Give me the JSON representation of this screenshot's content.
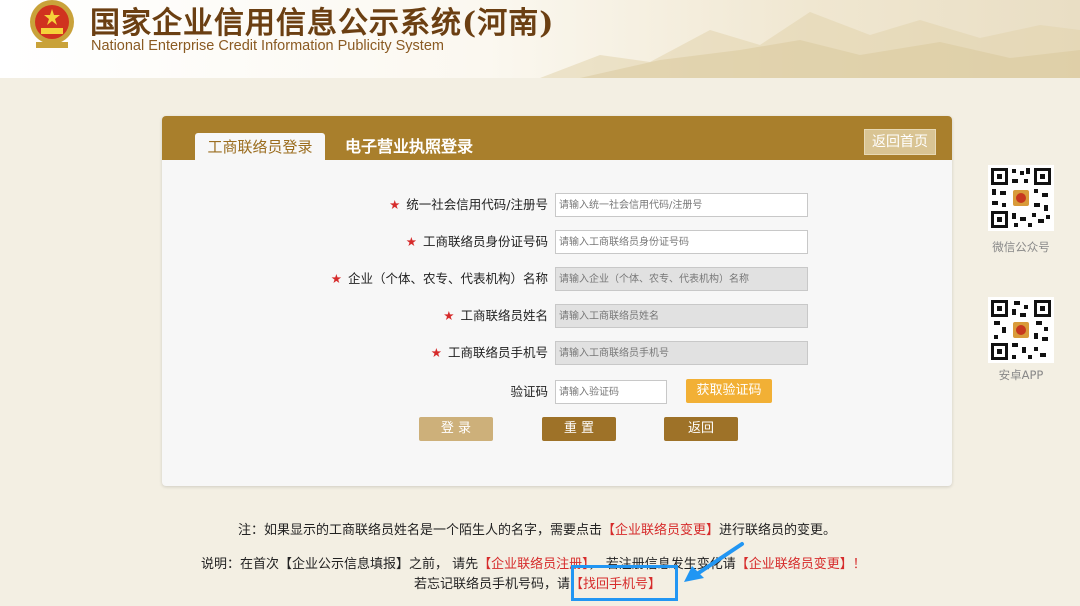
{
  "header": {
    "title_cn": "国家企业信用信息公示系统(河南)",
    "title_en": "National Enterprise Credit Information Publicity System"
  },
  "tabs": {
    "active": "工商联络员登录",
    "inactive": "电子营业执照登录",
    "home_button": "返回首页"
  },
  "form": {
    "fields": [
      {
        "label": "统一社会信用代码/注册号",
        "required": true,
        "placeholder": "请输入统一社会信用代码/注册号",
        "disabled": false
      },
      {
        "label": "工商联络员身份证号码",
        "required": true,
        "placeholder": "请输入工商联络员身份证号码",
        "disabled": false
      },
      {
        "label": "企业（个体、农专、代表机构）名称",
        "required": true,
        "placeholder": "请输入企业（个体、农专、代表机构）名称",
        "disabled": true
      },
      {
        "label": "工商联络员姓名",
        "required": true,
        "placeholder": "请输入工商联络员姓名",
        "disabled": true
      },
      {
        "label": "工商联络员手机号",
        "required": true,
        "placeholder": "请输入工商联络员手机号",
        "disabled": true
      }
    ],
    "star": "★",
    "captcha_label": "验证码",
    "captcha_placeholder": "请输入验证码",
    "get_code_button": "获取验证码",
    "login_button": "登 录",
    "reset_button": "重 置",
    "back_button": "返回"
  },
  "side": {
    "wechat_label": "微信公众号",
    "android_label": "安卓APP"
  },
  "notes": {
    "note1_prefix": "注：如果显示的工商联络员姓名是一个陌生人的名字，需要点击",
    "note1_link": "【企业联络员变更】",
    "note1_suffix": "进行联络员的变更。",
    "note2_prefix": "说明：在首次【企业公示信息填报】之前，  请先",
    "note2_link1": "【企业联络员注册】",
    "note2_middle": "，  若注册信息发生变化请",
    "note2_link2": "【企业联络员变更】！",
    "note3_prefix": "若忘记联络员手机号码，请",
    "note3_link": "【找回手机号】"
  },
  "colors": {
    "brand": "#a97f2c",
    "accent_button": "#f2b035",
    "link_red": "#d62b2b",
    "highlight_blue": "#2196f3"
  }
}
